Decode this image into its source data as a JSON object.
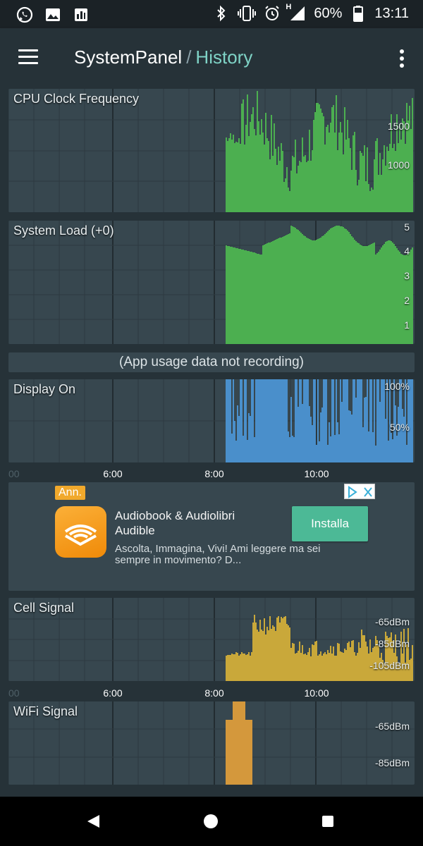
{
  "status_bar": {
    "left_icons": [
      "whatsapp-icon",
      "gallery-icon",
      "chart-app-icon"
    ],
    "battery_percent": "60%",
    "time": "13:11",
    "network_label": "H"
  },
  "app_bar": {
    "title": "SystemPanel",
    "separator": "/",
    "subtitle": "History"
  },
  "colors": {
    "cpu": "#4caf50",
    "load": "#4caf50",
    "display": "#4a8fcb",
    "cell": "#c9a83a",
    "wifi": "#d4983c",
    "panel_bg": "#37474f",
    "grid": "#263238",
    "accent": "#7fd3c6"
  },
  "panels": {
    "cpu": {
      "title": "CPU Clock Frequency",
      "labels": [
        "1500",
        "1000"
      ]
    },
    "load": {
      "title": "System Load (+0)",
      "labels": [
        "5",
        "4",
        "3",
        "2",
        "1"
      ]
    },
    "not_recording": "(App usage data not recording)",
    "display": {
      "title": "Display On",
      "labels": [
        "100%",
        "50%"
      ]
    },
    "cell": {
      "title": "Cell Signal",
      "labels": [
        "-65dBm",
        "-85dBm",
        "-105dBm"
      ]
    },
    "wifi": {
      "title": "WiFi Signal",
      "labels": [
        "-65dBm",
        "-85dBm"
      ]
    }
  },
  "time_axis": {
    "edge": "00",
    "ticks": [
      "6:00",
      "8:00",
      "10:00"
    ]
  },
  "ad": {
    "badge": "Ann.",
    "title": "Audiobook & Audiolibri",
    "advertiser": "Audible",
    "description": "Ascolta, Immagina, Vivi! Ami leggere ma sei sempre in movimento? D...",
    "cta": "Installa"
  },
  "nav": {
    "icons": [
      "back-icon",
      "home-icon",
      "recents-icon"
    ]
  }
}
